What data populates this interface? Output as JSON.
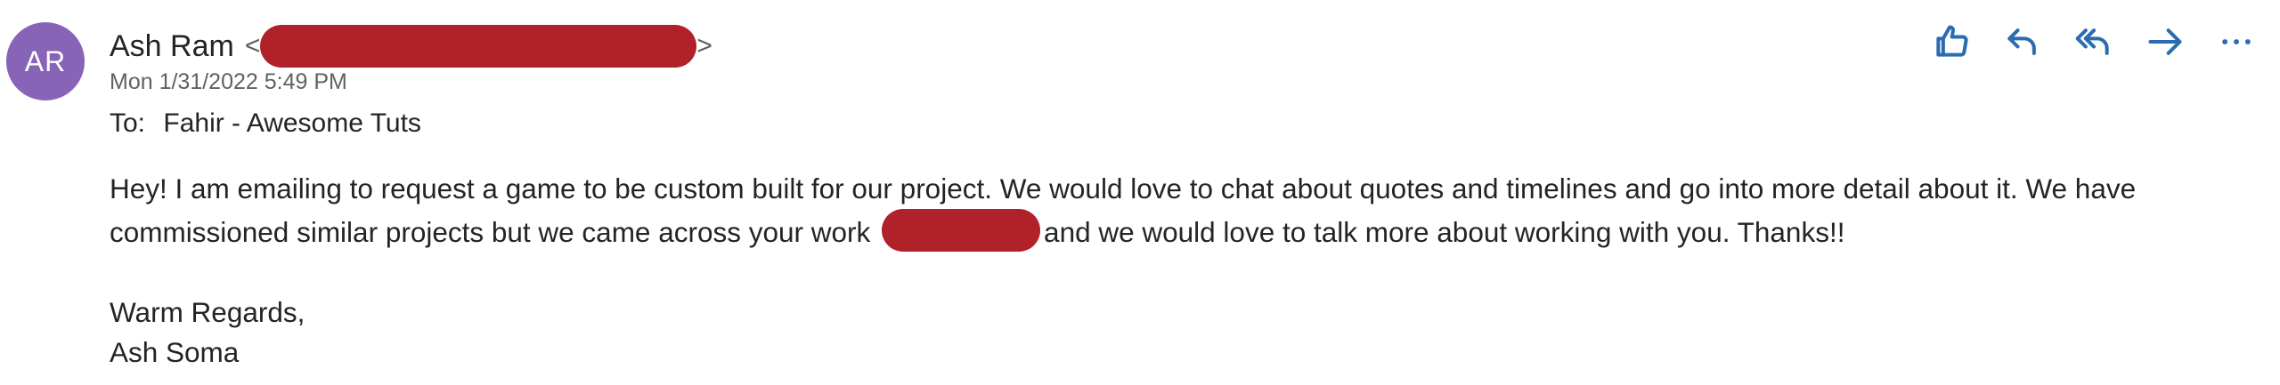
{
  "sender": {
    "initials": "AR",
    "name": "Ash Ram",
    "email_open": "<",
    "email_close": ">",
    "avatar_color": "#8764b8"
  },
  "timestamp": "Mon 1/31/2022 5:49 PM",
  "recipient": {
    "label": "To:",
    "name": "Fahir - Awesome Tuts"
  },
  "body": {
    "text_before_redaction": "Hey! I am emailing to request a game to be custom built for our project. We would love to chat about quotes and timelines and go into more detail about it. We have commissioned similar projects but we came across your work",
    "text_after_redaction": "and we would love to talk more about working with you. Thanks!!",
    "signoff": "Warm Regards,",
    "signature": "Ash Soma"
  },
  "toolbar": {
    "actions": [
      "like-icon",
      "reply-icon",
      "reply-all-icon",
      "forward-icon",
      "more-icon"
    ],
    "accent_color": "#2b6cb0"
  },
  "redaction_color": "#b0212a"
}
